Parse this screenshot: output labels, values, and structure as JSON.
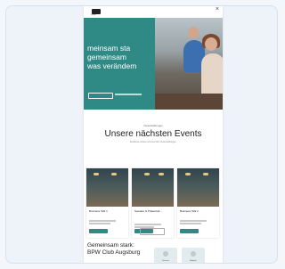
{
  "header": {
    "logo_text": "CLUB",
    "close_symbol": "×"
  },
  "hero": {
    "headline_lines": [
      "meinsam sta",
      "gemeinsam",
      "was verändem"
    ]
  },
  "events": {
    "kicker": "Veranstaltungen",
    "title": "Unsere nächsten Events",
    "subtitle": "Entdecke unsere kommenden Veranstaltungen",
    "cards": [
      {
        "title": "Business Talk 1"
      },
      {
        "title": "Speaker & Präsentati..."
      },
      {
        "title": "Business Talk 2"
      }
    ]
  },
  "bottom": {
    "title_lines": [
      "Gemeinsam stark:",
      "BPW Club Augsburg"
    ],
    "chips": [
      {
        "label": "Netzwerk"
      },
      {
        "label": "Mitglieder"
      }
    ]
  }
}
